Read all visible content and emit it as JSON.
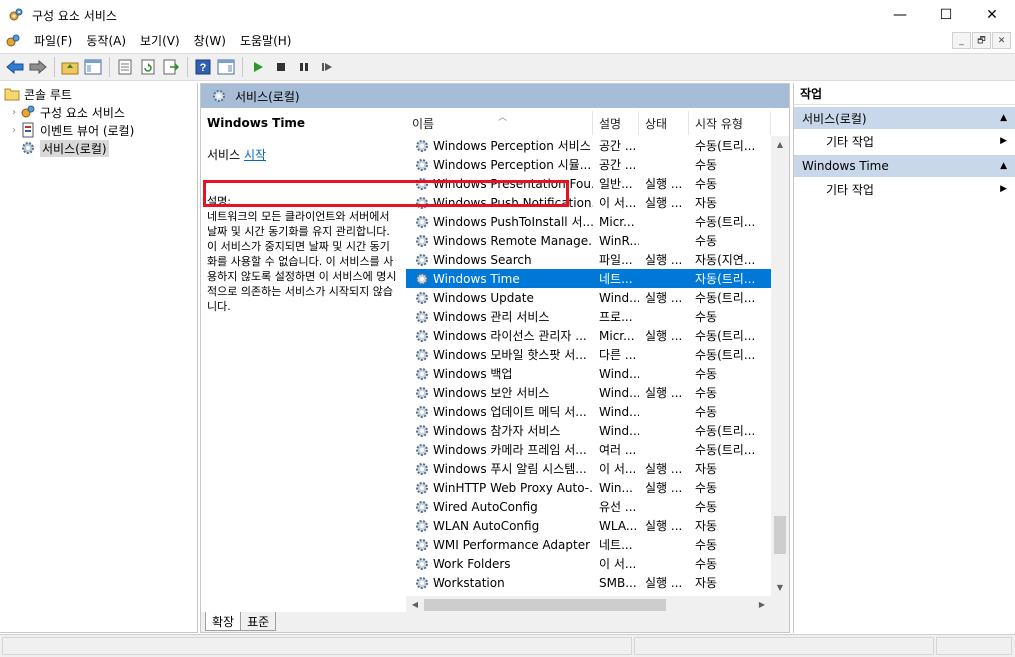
{
  "window": {
    "title": "구성 요소 서비스",
    "minimize": "—",
    "maximize": "☐",
    "close": "✕"
  },
  "menu": [
    "파일(F)",
    "동작(A)",
    "보기(V)",
    "창(W)",
    "도움말(H)"
  ],
  "mdi": {
    "minimize": "_",
    "restore": "🗗",
    "close": "✕"
  },
  "tree": {
    "root": "콘솔 루트",
    "items": [
      "구성 요소 서비스",
      "이벤트 뷰어 (로컬)",
      "서비스(로컬)"
    ]
  },
  "center": {
    "header": "서비스(로컬)",
    "tabs": [
      "확장",
      "표준"
    ]
  },
  "description": {
    "service_name": "Windows Time",
    "link_prefix": "서비스 ",
    "link_text": "시작",
    "label": "설명:",
    "text": "네트워크의 모든 클라이언트와 서버에서 날짜 및 시간 동기화를 유지 관리합니다. 이 서비스가 중지되면 날짜 및 시간 동기화를 사용할 수 없습니다. 이 서비스를 사용하지 않도록 설정하면 이 서비스에 명시적으로 의존하는 서비스가 시작되지 않습니다."
  },
  "list": {
    "columns": [
      "이름",
      "설명",
      "상태",
      "시작 유형"
    ],
    "rows": [
      {
        "name": "Windows Perception 서비스",
        "desc": "공간 ...",
        "status": "",
        "start": "수동(트리..."
      },
      {
        "name": "Windows Perception 시뮬...",
        "desc": "공간 ...",
        "status": "",
        "start": "수동"
      },
      {
        "name": "Windows Presentation Fou...",
        "desc": "일반...",
        "status": "실행 ...",
        "start": "수동"
      },
      {
        "name": "Windows Push Notification...",
        "desc": "이 서...",
        "status": "실행 ...",
        "start": "자동"
      },
      {
        "name": "Windows PushToInstall 서...",
        "desc": "Micr...",
        "status": "",
        "start": "수동(트리..."
      },
      {
        "name": "Windows Remote Manage...",
        "desc": "WinR...",
        "status": "",
        "start": "수동"
      },
      {
        "name": "Windows Search",
        "desc": "파일...",
        "status": "실행 ...",
        "start": "자동(지연..."
      },
      {
        "name": "Windows Time",
        "desc": "네트...",
        "status": "",
        "start": "자동(트리..."
      },
      {
        "name": "Windows Update",
        "desc": "Wind...",
        "status": "실행 ...",
        "start": "수동(트리..."
      },
      {
        "name": "Windows 관리 서비스",
        "desc": "프로...",
        "status": "",
        "start": "수동"
      },
      {
        "name": "Windows 라이선스 관리자 ...",
        "desc": "Micr...",
        "status": "실행 ...",
        "start": "수동(트리..."
      },
      {
        "name": "Windows 모바일 핫스팟 서...",
        "desc": "다른 ...",
        "status": "",
        "start": "수동(트리..."
      },
      {
        "name": "Windows 백업",
        "desc": "Wind...",
        "status": "",
        "start": "수동"
      },
      {
        "name": "Windows 보안 서비스",
        "desc": "Wind...",
        "status": "실행 ...",
        "start": "수동"
      },
      {
        "name": "Windows 업데이트 메딕 서...",
        "desc": "Wind...",
        "status": "",
        "start": "수동"
      },
      {
        "name": "Windows 참가자 서비스",
        "desc": "Wind...",
        "status": "",
        "start": "수동(트리..."
      },
      {
        "name": "Windows 카메라 프레임 서...",
        "desc": "여러 ...",
        "status": "",
        "start": "수동(트리..."
      },
      {
        "name": "Windows 푸시 알림 시스템...",
        "desc": "이 서...",
        "status": "실행 ...",
        "start": "자동"
      },
      {
        "name": "WinHTTP Web Proxy Auto-...",
        "desc": "Win...",
        "status": "실행 ...",
        "start": "수동"
      },
      {
        "name": "Wired AutoConfig",
        "desc": "유선 ...",
        "status": "",
        "start": "수동"
      },
      {
        "name": "WLAN AutoConfig",
        "desc": "WLA...",
        "status": "실행 ...",
        "start": "자동"
      },
      {
        "name": "WMI Performance Adapter",
        "desc": "네트...",
        "status": "",
        "start": "수동"
      },
      {
        "name": "Work Folders",
        "desc": "이 서...",
        "status": "",
        "start": "수동"
      },
      {
        "name": "Workstation",
        "desc": "SMB...",
        "status": "실행 ...",
        "start": "자동"
      }
    ],
    "selected_index": 7
  },
  "actions": {
    "title": "작업",
    "sections": [
      {
        "label": "서비스(로컬)",
        "item": "기타 작업"
      },
      {
        "label": "Windows Time",
        "item": "기타 작업"
      }
    ]
  },
  "colors": {
    "selection": "#0078d7",
    "header_band": "#a7bcd6",
    "action_section": "#c9d7ea",
    "highlight_border": "#e81123"
  }
}
